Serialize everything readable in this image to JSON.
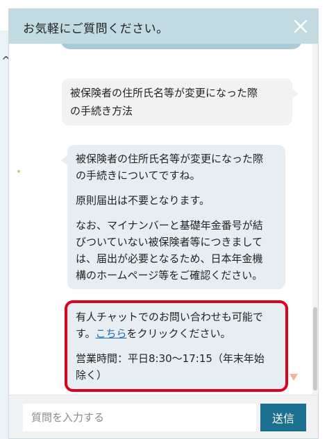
{
  "header": {
    "title": "お気軽にご質問ください。",
    "close_icon": "close-icon"
  },
  "messages": {
    "user": {
      "line1": "被保険者の住所氏名等が変更になった際",
      "line2": "の手続き方法"
    },
    "bot1": {
      "p1_line1": "被保険者の住所氏名等が変更になった際",
      "p1_line2": "の手続きについてですね。",
      "p2": "原則届出は不要となります。",
      "p3_line1": "なお、マイナンバーと基礎年金番号が結",
      "p3_line2": "びついていない被保険者等につきまして",
      "p3_line3": "は、届出が必要となるため、日本年金機",
      "p3_line4": "構のホームページ等をご確認ください。"
    },
    "bot2": {
      "p1_line1": "有人チャットでのお問い合わせも可能で",
      "p1_line2_pre": "す。",
      "p1_link": "こちら",
      "p1_line2_post": "をクリックください。",
      "p2_line1": "営業時間：平日8:30～17:15（年末年始",
      "p2_line2": "除く）"
    }
  },
  "input": {
    "placeholder": "質問を入力する",
    "value": ""
  },
  "send_label": "送信",
  "colors": {
    "header_bg": "#c2dbe3",
    "send_bg": "#1b6f8f",
    "highlight": "#e0001b",
    "link": "#1f6fb0"
  }
}
